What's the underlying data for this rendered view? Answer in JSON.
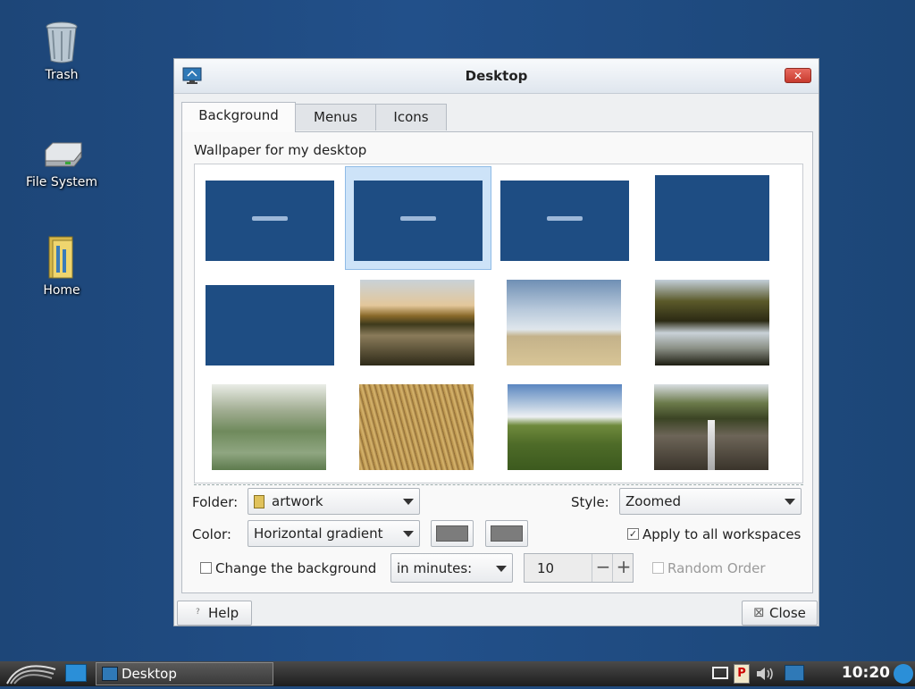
{
  "desktop": {
    "icons": [
      {
        "label": "Trash"
      },
      {
        "label": "File System"
      },
      {
        "label": "Home"
      }
    ]
  },
  "window": {
    "title": "Desktop",
    "close_symbol": "✕"
  },
  "tabs": [
    {
      "label": "Background",
      "active": true
    },
    {
      "label": "Menus",
      "active": false
    },
    {
      "label": "Icons",
      "active": false
    }
  ],
  "background": {
    "wallpaper_label": "Wallpaper for my desktop",
    "selected_index": 1,
    "folder_label": "Folder:",
    "folder_value": "artwork",
    "style_label": "Style:",
    "style_value": "Zoomed",
    "color_label": "Color:",
    "color_value": "Horizontal gradient",
    "color1": "#7c7c7c",
    "color2": "#7c7c7c",
    "apply_all_label": "Apply to all workspaces",
    "apply_all_checked": true,
    "change_bg_label": "Change the background",
    "change_bg_checked": false,
    "interval_unit": "in minutes:",
    "interval_value": "10",
    "random_order_label": "Random Order",
    "random_order_checked": false
  },
  "buttons": {
    "help": "Help",
    "close": "Close",
    "help_icon": "?",
    "close_icon": "⊠"
  },
  "taskbar": {
    "task_label": "Desktop",
    "clock": "10:20"
  }
}
